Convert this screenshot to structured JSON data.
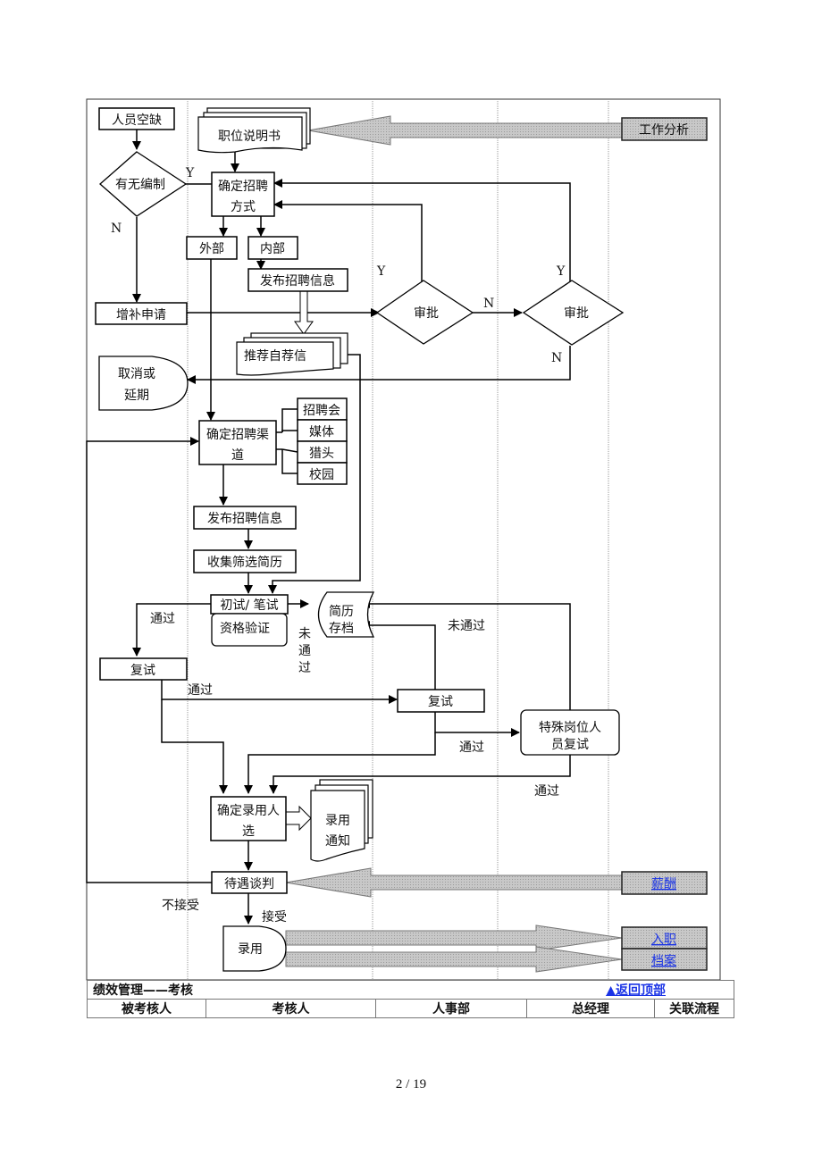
{
  "diagram": {
    "nodes": {
      "vacancy": "人员空缺",
      "job_desc": "职位说明书",
      "job_analysis": "工作分析",
      "headcount_check": "有无编制",
      "decide_method_1": "确定招聘",
      "decide_method_2": "方式",
      "external": "外部",
      "internal": "内部",
      "publish_internal": "发布招聘信息",
      "supplement_request": "增补申请",
      "approval_1": "审批",
      "approval_2": "审批",
      "referral": "推荐自荐信",
      "cancel_1": "取消或",
      "cancel_2": "延期",
      "decide_channel_1": "确定招聘渠",
      "decide_channel_2": "道",
      "channels": [
        "招聘会",
        "媒体",
        "猎头",
        "校园"
      ],
      "publish_external": "发布招聘信息",
      "collect_resume": "收集筛选简历",
      "first_interview": "初试/ 笔试",
      "qualification": "资格验证",
      "resume_archive_1": "简历",
      "resume_archive_2": "存档",
      "second_interview_left": "复试",
      "second_interview_mid": "复试",
      "special_1": "特殊岗位人",
      "special_2": "员复试",
      "decide_hire_1": "确定录用人",
      "decide_hire_2": "选",
      "offer_1": "录用",
      "offer_2": "通知",
      "negotiation": "待遇谈判",
      "hire": "录用"
    },
    "labels": {
      "yes": "Y",
      "no": "N",
      "pass": "通过",
      "fail": "未通过",
      "fail_v": [
        "未",
        "通",
        "过"
      ],
      "reject": "不接受",
      "accept": "接受"
    },
    "links": {
      "salary": "薪酬",
      "onboarding": "入职",
      "archive": "档案"
    }
  },
  "footer": {
    "section_title": "绩效管理——考核",
    "back_to_top": "▲返回顶部",
    "columns": [
      "被考核人",
      "考核人",
      "人事部",
      "总经理",
      "关联流程"
    ]
  },
  "page": {
    "number": "2 / 19"
  }
}
